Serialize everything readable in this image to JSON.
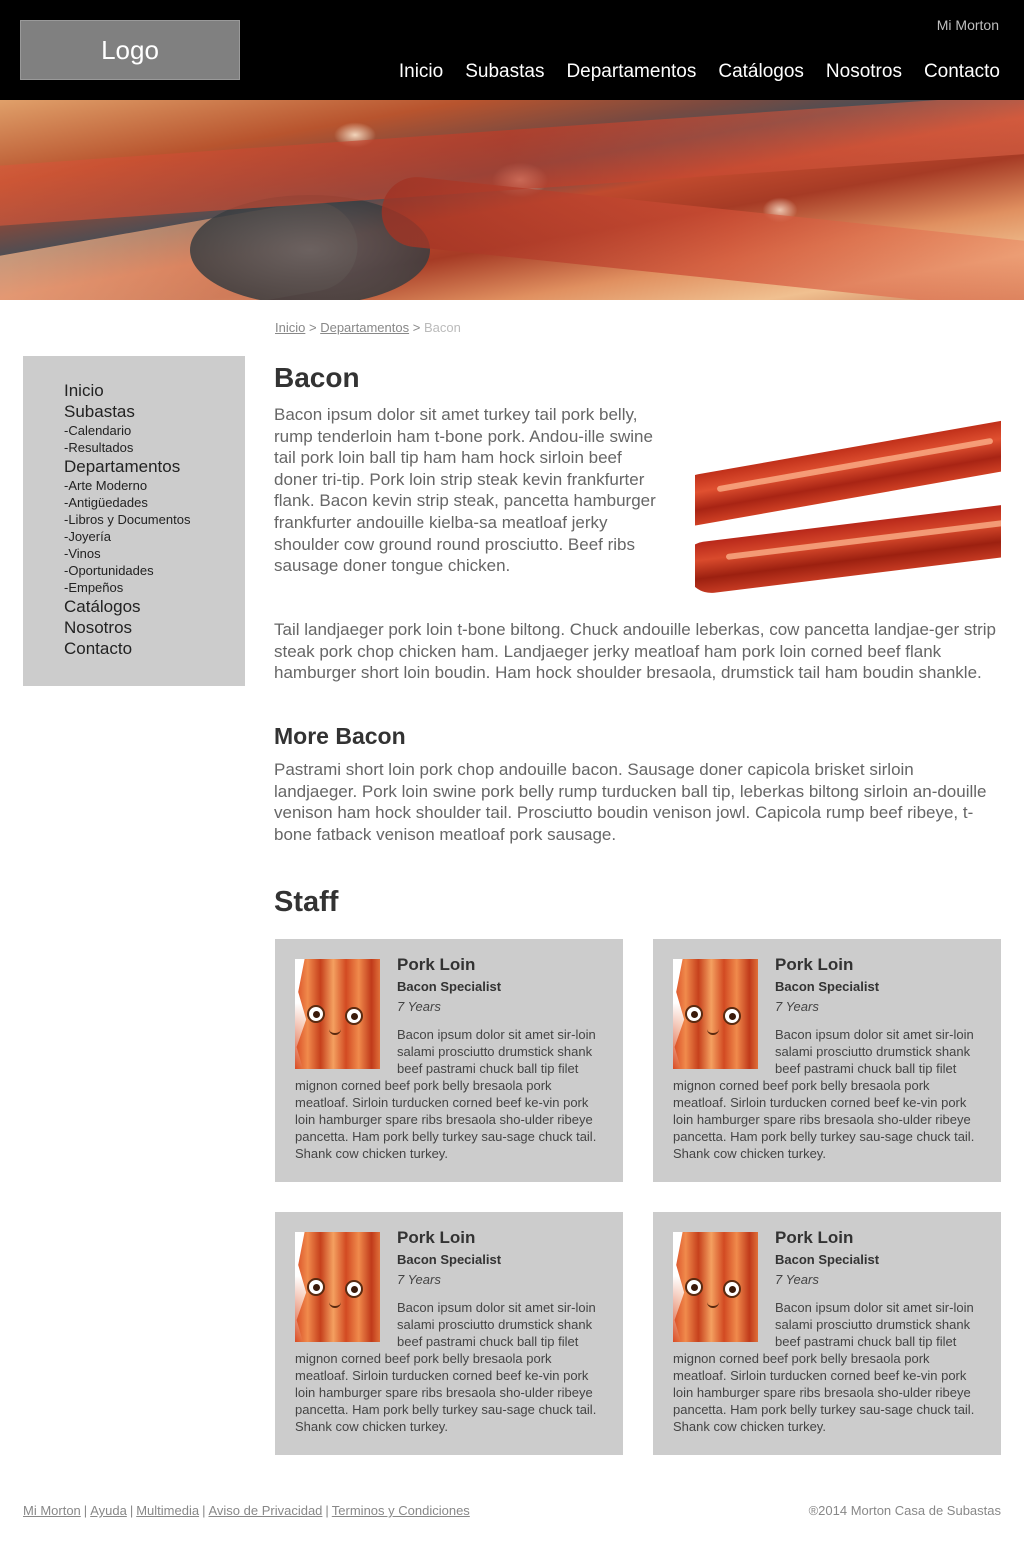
{
  "header": {
    "logo": "Logo",
    "account_link": "Mi Morton",
    "nav": [
      "Inicio",
      "Subastas",
      "Departamentos",
      "Catálogos",
      "Nosotros",
      "Contacto"
    ]
  },
  "breadcrumb": {
    "items": [
      "Inicio",
      "Departamentos"
    ],
    "separator": ">",
    "current": "Bacon"
  },
  "sidebar": {
    "items": [
      {
        "label": "Inicio",
        "level": "main"
      },
      {
        "label": "Subastas",
        "level": "main"
      },
      {
        "label": "-Calendario",
        "level": "sub"
      },
      {
        "label": "-Resultados",
        "level": "sub"
      },
      {
        "label": "Departamentos",
        "level": "main"
      },
      {
        "label": "-Arte Moderno",
        "level": "sub"
      },
      {
        "label": "-Antigüedades",
        "level": "sub"
      },
      {
        "label": "-Libros y Documentos",
        "level": "sub"
      },
      {
        "label": "-Joyería",
        "level": "sub"
      },
      {
        "label": "-Vinos",
        "level": "sub"
      },
      {
        "label": "-Oportunidades",
        "level": "sub"
      },
      {
        "label": "-Empeños",
        "level": "sub"
      },
      {
        "label": "Catálogos",
        "level": "main"
      },
      {
        "label": "Nosotros",
        "level": "main"
      },
      {
        "label": "Contacto",
        "level": "main"
      }
    ]
  },
  "content": {
    "title": "Bacon",
    "intro": "Bacon ipsum dolor sit amet turkey tail pork belly, rump tenderloin ham t-bone pork. Andou-ille swine tail pork loin ball tip ham ham hock sirloin beef doner tri-tip. Pork loin strip steak kevin frankfurter flank. Bacon kevin strip steak, pancetta hamburger frankfurter andouille kielba-sa meatloaf jerky shoulder cow ground round prosciutto. Beef ribs sausage doner tongue chicken.",
    "paragraph2": "Tail landjaeger pork loin t-bone biltong. Chuck andouille leberkas, cow pancetta landjae-ger strip steak pork chop chicken ham. Landjaeger jerky meatloaf ham pork loin corned beef flank hamburger short loin boudin. Ham hock shoulder bresaola, drumstick tail ham boudin shankle.",
    "subtitle": "More Bacon",
    "paragraph3": "Pastrami short loin pork chop andouille bacon. Sausage doner capicola brisket sirloin landjaeger. Pork loin swine pork belly rump turducken ball tip, leberkas biltong sirloin an-douille venison ham hock shoulder tail. Prosciutto boudin venison jowl. Capicola rump beef ribeye, t-bone fatback venison meatloaf pork sausage.",
    "staff_title": "Staff"
  },
  "staff": [
    {
      "name": "Pork Loin",
      "role": "Bacon Specialist",
      "years": "7 Years",
      "bio": "Bacon ipsum dolor sit amet sir-loin salami prosciutto drumstick shank beef pastrami chuck ball tip filet mignon corned beef pork belly bresaola pork meatloaf. Sirloin turducken corned beef ke-vin pork loin hamburger spare ribs bresaola sho-ulder ribeye pancetta. Ham pork belly turkey sau-sage chuck tail. Shank cow chicken turkey."
    },
    {
      "name": "Pork Loin",
      "role": "Bacon Specialist",
      "years": "7 Years",
      "bio": "Bacon ipsum dolor sit amet sir-loin salami prosciutto drumstick shank beef pastrami chuck ball tip filet mignon corned beef pork belly bresaola pork meatloaf. Sirloin turducken corned beef ke-vin pork loin hamburger spare ribs bresaola sho-ulder ribeye pancetta. Ham pork belly turkey sau-sage chuck tail. Shank cow chicken turkey."
    },
    {
      "name": "Pork Loin",
      "role": "Bacon Specialist",
      "years": "7 Years",
      "bio": "Bacon ipsum dolor sit amet sir-loin salami prosciutto drumstick shank beef pastrami chuck ball tip filet mignon corned beef pork belly bresaola pork meatloaf. Sirloin turducken corned beef ke-vin pork loin hamburger spare ribs bresaola sho-ulder ribeye pancetta. Ham pork belly turkey sau-sage chuck tail. Shank cow chicken turkey."
    },
    {
      "name": "Pork Loin",
      "role": "Bacon Specialist",
      "years": "7 Years",
      "bio": "Bacon ipsum dolor sit amet sir-loin salami prosciutto drumstick shank beef pastrami chuck ball tip filet mignon corned beef pork belly bresaola pork meatloaf. Sirloin turducken corned beef ke-vin pork loin hamburger spare ribs bresaola sho-ulder ribeye pancetta. Ham pork belly turkey sau-sage chuck tail. Shank cow chicken turkey."
    }
  ],
  "footer": {
    "links": [
      "Mi Morton",
      "Ayuda",
      "Multimedia",
      "Aviso de Privacidad",
      "Terminos y Condiciones"
    ],
    "copyright": "®2014 Morton Casa de Subastas"
  },
  "colors": {
    "header_bg": "#000000",
    "logo_bg": "#808080",
    "sidebar_bg": "#cccccc",
    "card_bg": "#cccccc"
  }
}
